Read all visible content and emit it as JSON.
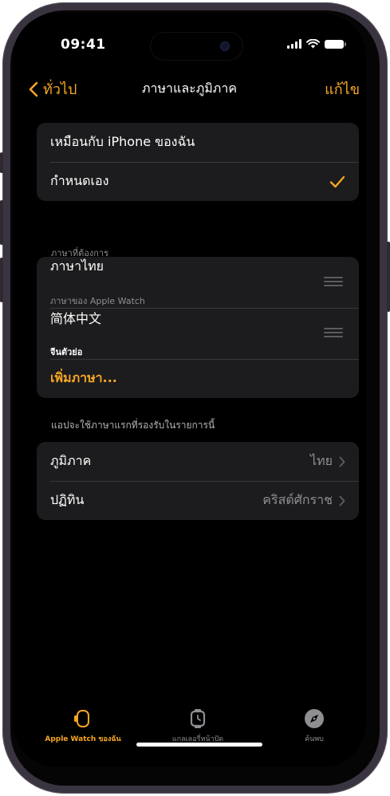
{
  "status_bar": {
    "time": "09:41"
  },
  "nav": {
    "back_label": "ทั่วไป",
    "title": "ภาษาและภูมิภาค",
    "edit_label": "แก้ไข"
  },
  "language_mode": {
    "items": [
      {
        "label": "เหมือนกับ iPhone ของฉัน",
        "selected": false
      },
      {
        "label": "กำหนดเอง",
        "selected": true
      }
    ]
  },
  "preferred_languages": {
    "header": "ภาษาที่ต้องการ",
    "items": [
      {
        "name": "ภาษาไทย",
        "subtitle": "ภาษาของ Apple Watch"
      },
      {
        "name": "简体中文",
        "subtitle": "จีนตัวย่อ"
      }
    ],
    "add_label": "เพิ่มภาษา...",
    "footer": "แอปจะใช้ภาษาแรกที่รองรับในรายการนี้"
  },
  "region_settings": {
    "items": [
      {
        "label": "ภูมิภาค",
        "value": "ไทย"
      },
      {
        "label": "ปฏิทิน",
        "value": "คริสต์ศักราช"
      }
    ]
  },
  "tab_bar": {
    "tabs": [
      {
        "label": "Apple Watch ของฉัน",
        "icon": "watch-icon",
        "active": true
      },
      {
        "label": "แกลเลอรี่หน้าปัด",
        "icon": "face-gallery-icon",
        "active": false
      },
      {
        "label": "ค้นพบ",
        "icon": "compass-icon",
        "active": false
      }
    ]
  },
  "colors": {
    "accent": "#f5a623",
    "background": "#000000",
    "cell": "#1c1c1e",
    "secondary_text": "#8e8e93"
  }
}
